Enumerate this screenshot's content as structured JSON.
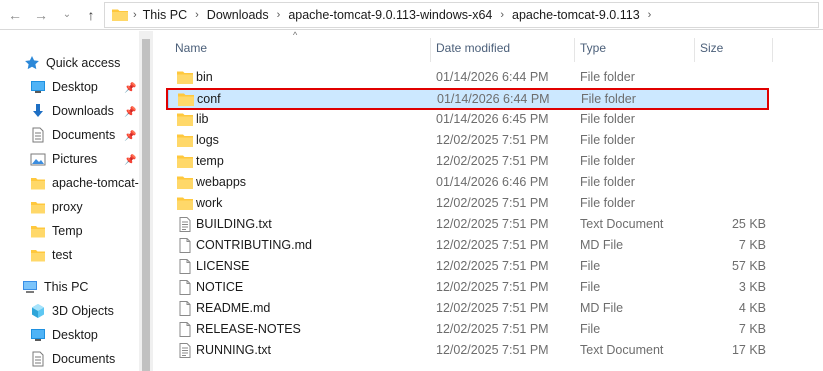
{
  "colors": {
    "accent": "#0078d7",
    "selection": "#cce8ff",
    "highlight_box": "#e00000",
    "folder": "#ffc83d"
  },
  "address": {
    "crumbs": [
      "This PC",
      "Downloads",
      "apache-tomcat-9.0.113-windows-x64",
      "apache-tomcat-9.0.113"
    ]
  },
  "sidebar": {
    "items": [
      {
        "label": "Quick access",
        "icon": "star-icon",
        "pinned": false
      },
      {
        "label": "Desktop",
        "icon": "desktop-icon",
        "pinned": true
      },
      {
        "label": "Downloads",
        "icon": "download-icon",
        "pinned": true
      },
      {
        "label": "Documents",
        "icon": "documents-icon",
        "pinned": true
      },
      {
        "label": "Pictures",
        "icon": "pictures-icon",
        "pinned": true
      },
      {
        "label": "apache-tomcat-",
        "icon": "folder-icon",
        "pinned": false
      },
      {
        "label": "proxy",
        "icon": "folder-icon",
        "pinned": false
      },
      {
        "label": "Temp",
        "icon": "folder-icon",
        "pinned": false
      },
      {
        "label": "test",
        "icon": "folder-icon",
        "pinned": false
      },
      {
        "label": "This PC",
        "icon": "computer-icon",
        "pinned": false
      },
      {
        "label": "3D Objects",
        "icon": "3d-objects-icon",
        "pinned": false
      },
      {
        "label": "Desktop",
        "icon": "desktop-icon",
        "pinned": false
      },
      {
        "label": "Documents",
        "icon": "documents-icon",
        "pinned": false
      }
    ]
  },
  "columns": {
    "name": "Name",
    "date": "Date modified",
    "type": "Type",
    "size": "Size"
  },
  "files": [
    {
      "name": "bin",
      "date": "01/14/2026 6:44 PM",
      "type": "File folder",
      "size": "",
      "kind": "folder"
    },
    {
      "name": "conf",
      "date": "01/14/2026 6:44 PM",
      "type": "File folder",
      "size": "",
      "kind": "folder",
      "selected": true
    },
    {
      "name": "lib",
      "date": "01/14/2026 6:45 PM",
      "type": "File folder",
      "size": "",
      "kind": "folder"
    },
    {
      "name": "logs",
      "date": "12/02/2025 7:51 PM",
      "type": "File folder",
      "size": "",
      "kind": "folder"
    },
    {
      "name": "temp",
      "date": "12/02/2025 7:51 PM",
      "type": "File folder",
      "size": "",
      "kind": "folder"
    },
    {
      "name": "webapps",
      "date": "01/14/2026 6:46 PM",
      "type": "File folder",
      "size": "",
      "kind": "folder"
    },
    {
      "name": "work",
      "date": "12/02/2025 7:51 PM",
      "type": "File folder",
      "size": "",
      "kind": "folder"
    },
    {
      "name": "BUILDING.txt",
      "date": "12/02/2025 7:51 PM",
      "type": "Text Document",
      "size": "25 KB",
      "kind": "textfile"
    },
    {
      "name": "CONTRIBUTING.md",
      "date": "12/02/2025 7:51 PM",
      "type": "MD File",
      "size": "7 KB",
      "kind": "file"
    },
    {
      "name": "LICENSE",
      "date": "12/02/2025 7:51 PM",
      "type": "File",
      "size": "57 KB",
      "kind": "file"
    },
    {
      "name": "NOTICE",
      "date": "12/02/2025 7:51 PM",
      "type": "File",
      "size": "3 KB",
      "kind": "file"
    },
    {
      "name": "README.md",
      "date": "12/02/2025 7:51 PM",
      "type": "MD File",
      "size": "4 KB",
      "kind": "file"
    },
    {
      "name": "RELEASE-NOTES",
      "date": "12/02/2025 7:51 PM",
      "type": "File",
      "size": "7 KB",
      "kind": "file"
    },
    {
      "name": "RUNNING.txt",
      "date": "12/02/2025 7:51 PM",
      "type": "Text Document",
      "size": "17 KB",
      "kind": "textfile"
    }
  ]
}
